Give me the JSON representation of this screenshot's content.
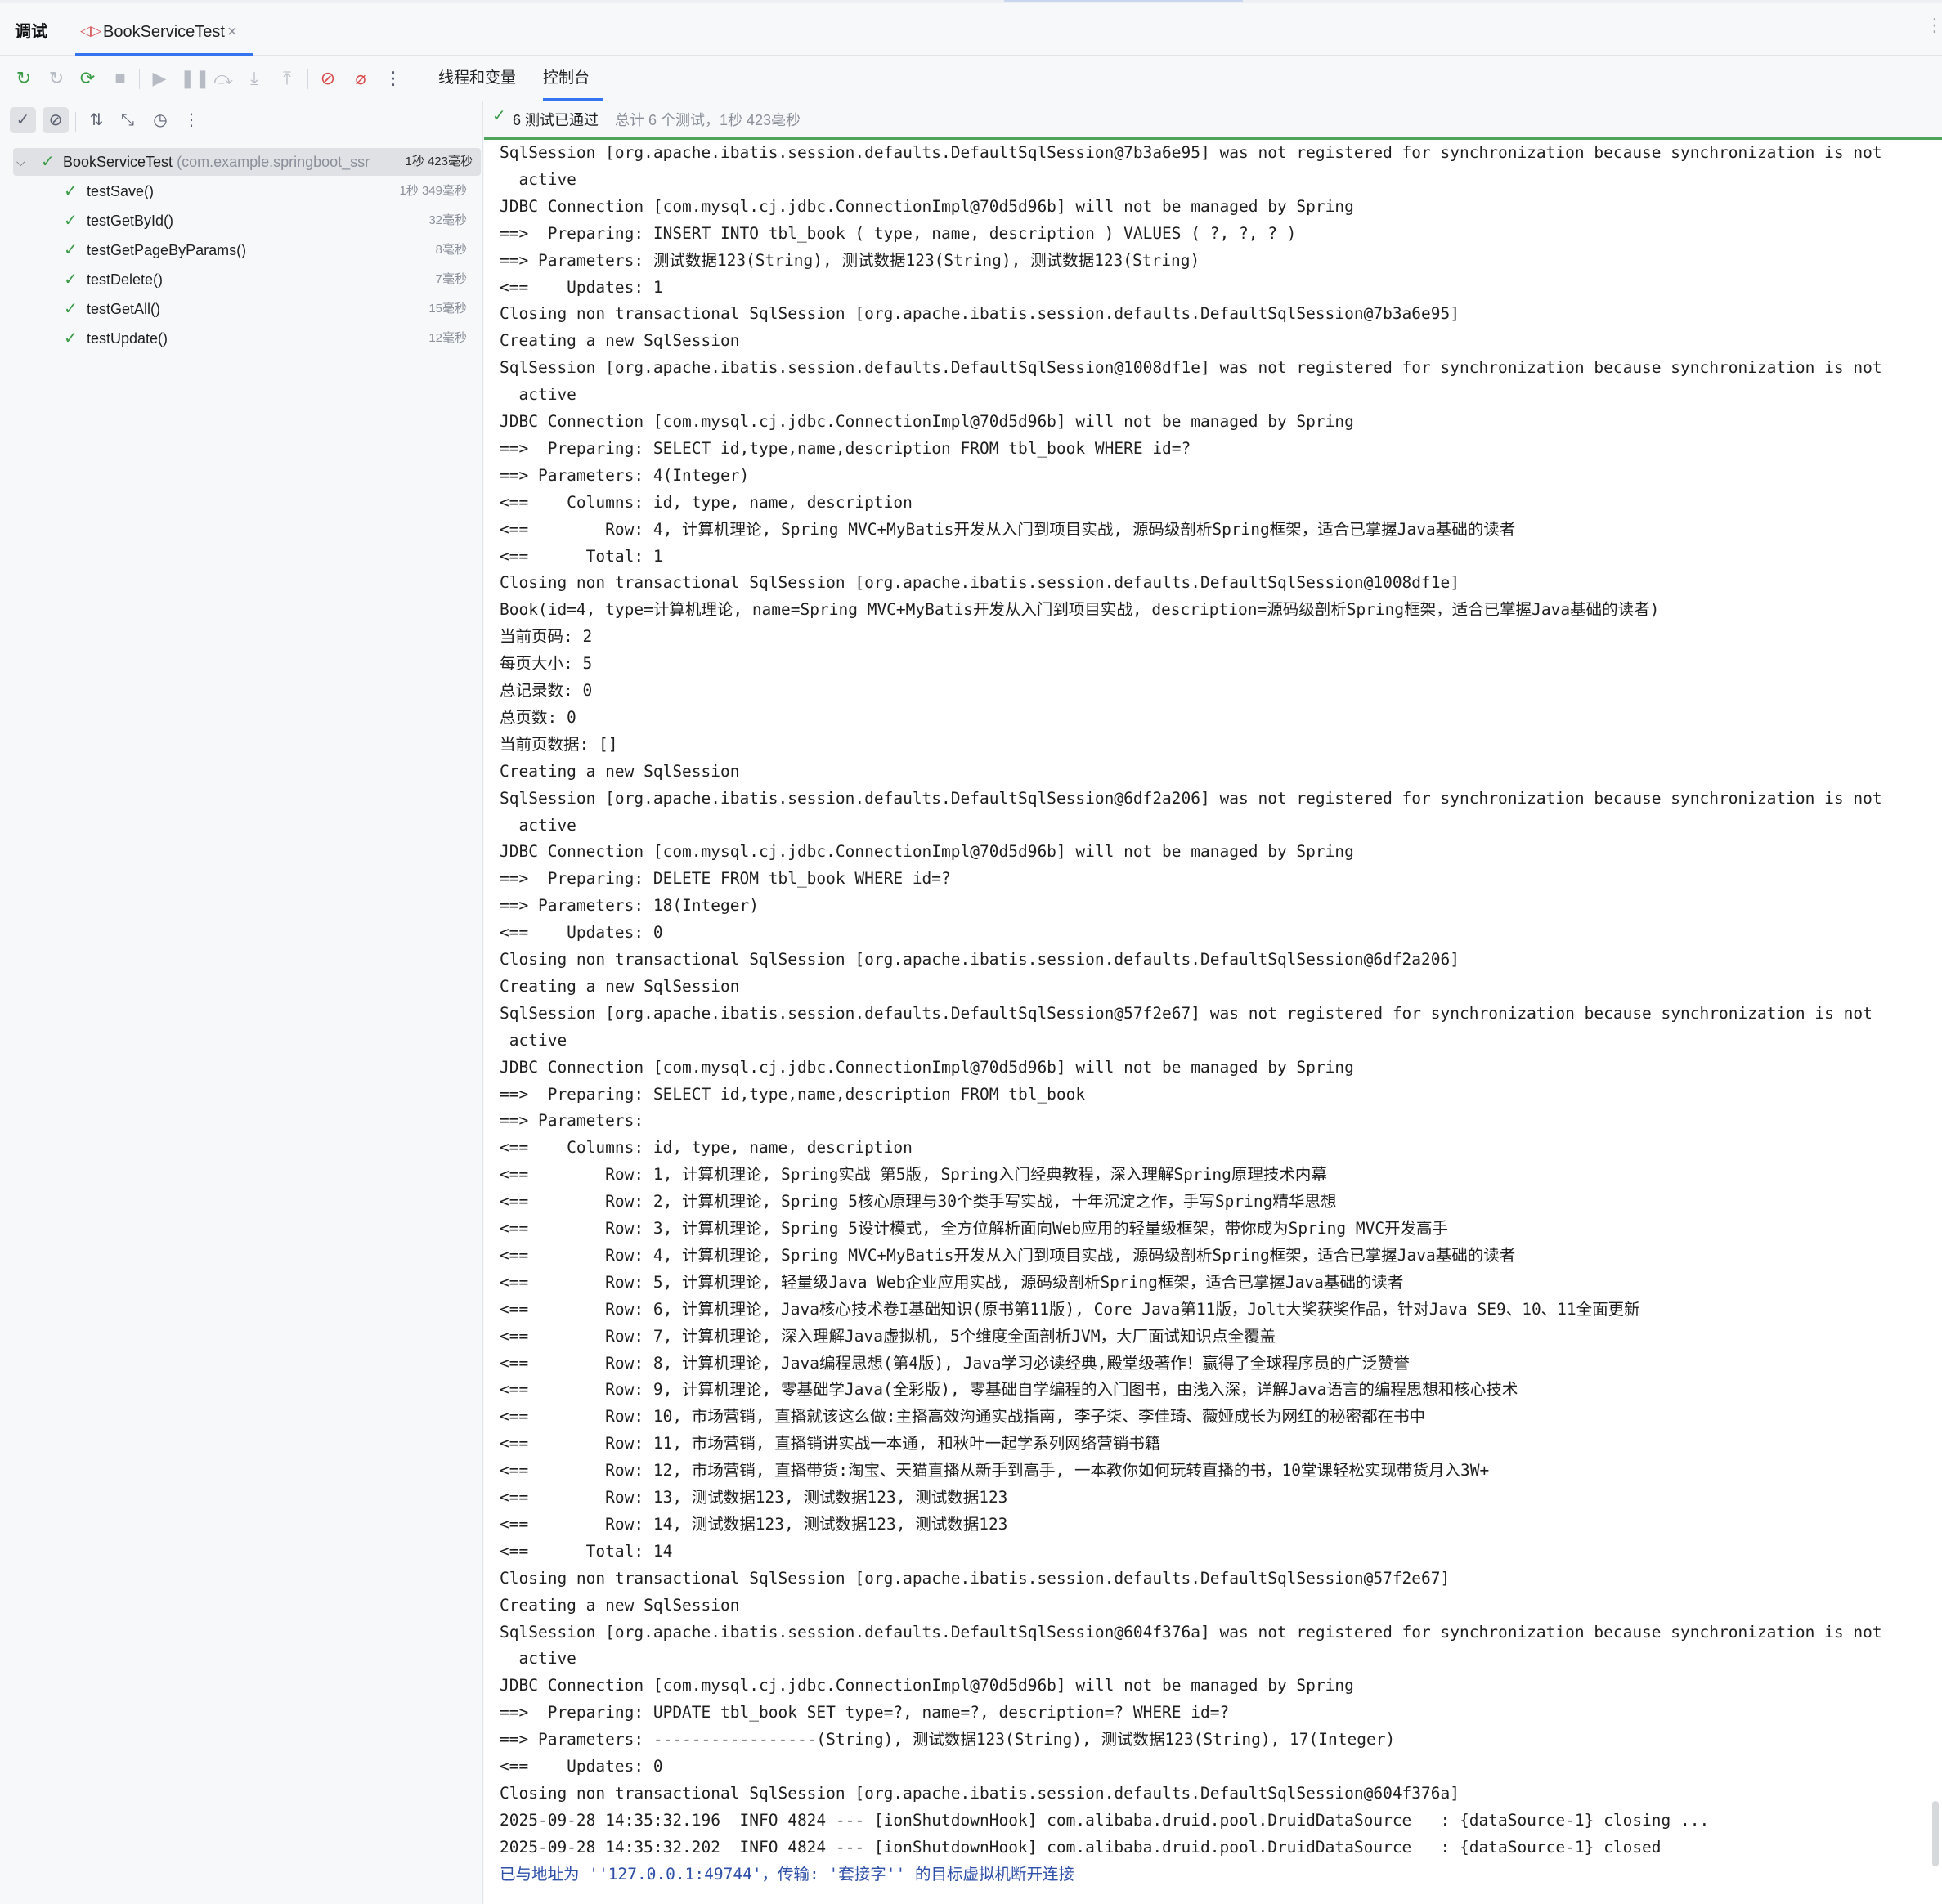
{
  "tabs": {
    "debug_label": "调试",
    "file_tab_label": "BookServiceTest",
    "close_glyph": "×"
  },
  "toolbar": {
    "threads_tab": "线程和变量",
    "console_tab": "控制台"
  },
  "tests": {
    "root": {
      "name": "BookServiceTest",
      "package": "(com.example.springboot_ssr",
      "time": "1秒 423毫秒"
    },
    "items": [
      {
        "name": "testSave()",
        "time": "1秒 349毫秒"
      },
      {
        "name": "testGetById()",
        "time": "32毫秒"
      },
      {
        "name": "testGetPageByParams()",
        "time": "8毫秒"
      },
      {
        "name": "testDelete()",
        "time": "7毫秒"
      },
      {
        "name": "testGetAll()",
        "time": "15毫秒"
      },
      {
        "name": "testUpdate()",
        "time": "12毫秒"
      }
    ]
  },
  "status": {
    "passed": "6 测试已通过",
    "total": "总计 6 个测试，1秒 423毫秒"
  },
  "console": {
    "lines": [
      "SqlSession [org.apache.ibatis.session.defaults.DefaultSqlSession@7b3a6e95] was not registered for synchronization because synchronization is not",
      "  active",
      "JDBC Connection [com.mysql.cj.jdbc.ConnectionImpl@70d5d96b] will not be managed by Spring",
      "==>  Preparing: INSERT INTO tbl_book ( type, name, description ) VALUES ( ?, ?, ? )",
      "==> Parameters: 测试数据123(String), 测试数据123(String), 测试数据123(String)",
      "<==    Updates: 1",
      "Closing non transactional SqlSession [org.apache.ibatis.session.defaults.DefaultSqlSession@7b3a6e95]",
      "Creating a new SqlSession",
      "SqlSession [org.apache.ibatis.session.defaults.DefaultSqlSession@1008df1e] was not registered for synchronization because synchronization is not",
      "  active",
      "JDBC Connection [com.mysql.cj.jdbc.ConnectionImpl@70d5d96b] will not be managed by Spring",
      "==>  Preparing: SELECT id,type,name,description FROM tbl_book WHERE id=?",
      "==> Parameters: 4(Integer)",
      "<==    Columns: id, type, name, description",
      "<==        Row: 4, 计算机理论, Spring MVC+MyBatis开发从入门到项目实战, 源码级剖析Spring框架，适合已掌握Java基础的读者",
      "<==      Total: 1",
      "Closing non transactional SqlSession [org.apache.ibatis.session.defaults.DefaultSqlSession@1008df1e]",
      "Book(id=4, type=计算机理论, name=Spring MVC+MyBatis开发从入门到项目实战, description=源码级剖析Spring框架，适合已掌握Java基础的读者)",
      "当前页码: 2",
      "每页大小: 5",
      "总记录数: 0",
      "总页数: 0",
      "当前页数据: []",
      "Creating a new SqlSession",
      "SqlSession [org.apache.ibatis.session.defaults.DefaultSqlSession@6df2a206] was not registered for synchronization because synchronization is not",
      "  active",
      "JDBC Connection [com.mysql.cj.jdbc.ConnectionImpl@70d5d96b] will not be managed by Spring",
      "==>  Preparing: DELETE FROM tbl_book WHERE id=?",
      "==> Parameters: 18(Integer)",
      "<==    Updates: 0",
      "Closing non transactional SqlSession [org.apache.ibatis.session.defaults.DefaultSqlSession@6df2a206]",
      "Creating a new SqlSession",
      "SqlSession [org.apache.ibatis.session.defaults.DefaultSqlSession@57f2e67] was not registered for synchronization because synchronization is not",
      " active",
      "JDBC Connection [com.mysql.cj.jdbc.ConnectionImpl@70d5d96b] will not be managed by Spring",
      "==>  Preparing: SELECT id,type,name,description FROM tbl_book",
      "==> Parameters: ",
      "<==    Columns: id, type, name, description",
      "<==        Row: 1, 计算机理论, Spring实战 第5版, Spring入门经典教程，深入理解Spring原理技术内幕",
      "<==        Row: 2, 计算机理论, Spring 5核心原理与30个类手写实战, 十年沉淀之作，手写Spring精华思想",
      "<==        Row: 3, 计算机理论, Spring 5设计模式, 全方位解析面向Web应用的轻量级框架，带你成为Spring MVC开发高手",
      "<==        Row: 4, 计算机理论, Spring MVC+MyBatis开发从入门到项目实战, 源码级剖析Spring框架，适合已掌握Java基础的读者",
      "<==        Row: 5, 计算机理论, 轻量级Java Web企业应用实战, 源码级剖析Spring框架，适合已掌握Java基础的读者",
      "<==        Row: 6, 计算机理论, Java核心技术卷I基础知识(原书第11版), Core Java第11版，Jolt大奖获奖作品，针对Java SE9、10、11全面更新",
      "<==        Row: 7, 计算机理论, 深入理解Java虚拟机, 5个维度全面剖析JVM，大厂面试知识点全覆盖",
      "<==        Row: 8, 计算机理论, Java编程思想(第4版), Java学习必读经典,殿堂级著作！赢得了全球程序员的广泛赞誉",
      "<==        Row: 9, 计算机理论, 零基础学Java(全彩版), 零基础自学编程的入门图书，由浅入深，详解Java语言的编程思想和核心技术",
      "<==        Row: 10, 市场营销, 直播就该这么做:主播高效沟通实战指南, 李子柒、李佳琦、薇娅成长为网红的秘密都在书中",
      "<==        Row: 11, 市场营销, 直播销讲实战一本通, 和秋叶一起学系列网络营销书籍",
      "<==        Row: 12, 市场营销, 直播带货:淘宝、天猫直播从新手到高手, 一本教你如何玩转直播的书，10堂课轻松实现带货月入3W+",
      "<==        Row: 13, 测试数据123, 测试数据123, 测试数据123",
      "<==        Row: 14, 测试数据123, 测试数据123, 测试数据123",
      "<==      Total: 14",
      "Closing non transactional SqlSession [org.apache.ibatis.session.defaults.DefaultSqlSession@57f2e67]",
      "Creating a new SqlSession",
      "SqlSession [org.apache.ibatis.session.defaults.DefaultSqlSession@604f376a] was not registered for synchronization because synchronization is not",
      "  active",
      "JDBC Connection [com.mysql.cj.jdbc.ConnectionImpl@70d5d96b] will not be managed by Spring",
      "==>  Preparing: UPDATE tbl_book SET type=?, name=?, description=? WHERE id=?",
      "==> Parameters: -----------------(String), 测试数据123(String), 测试数据123(String), 17(Integer)",
      "<==    Updates: 0",
      "Closing non transactional SqlSession [org.apache.ibatis.session.defaults.DefaultSqlSession@604f376a]",
      "2025-09-28 14:35:32.196  INFO 4824 --- [ionShutdownHook] com.alibaba.druid.pool.DruidDataSource   : {dataSource-1} closing ...",
      "2025-09-28 14:35:32.202  INFO 4824 --- [ionShutdownHook] com.alibaba.druid.pool.DruidDataSource   : {dataSource-1} closed",
      "已与地址为 ''127.0.0.1:49744'，传输: '套接字'' 的目标虚拟机断开连接"
    ]
  }
}
